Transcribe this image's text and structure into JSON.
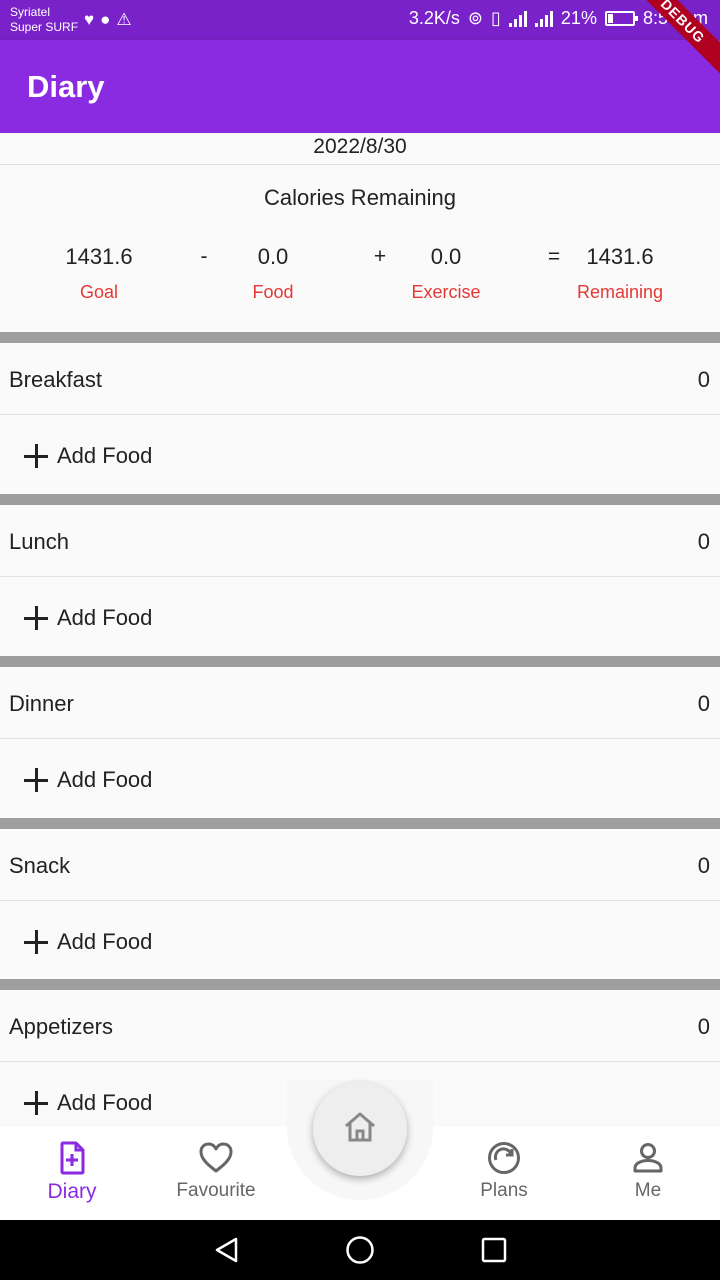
{
  "status_bar": {
    "carrier_line1": "Syriatel",
    "carrier_line2": "Super SURF",
    "net_speed": "3.2K/s",
    "battery_pct": "21%",
    "battery_level": 0.21,
    "time": "8:59 am"
  },
  "app_bar": {
    "title": "Diary",
    "debug_banner": "DEBUG"
  },
  "date": "2022/8/30",
  "calories": {
    "title": "Calories Remaining",
    "goal_value": "1431.6",
    "goal_label": "Goal",
    "minus": "-",
    "food_value": "0.0",
    "food_label": "Food",
    "plus": "+",
    "exercise_value": "0.0",
    "exercise_label": "Exercise",
    "equals": "=",
    "remaining_value": "1431.6",
    "remaining_label": "Remaining"
  },
  "meals": [
    {
      "name": "Breakfast",
      "count": "0",
      "add_label": "Add Food"
    },
    {
      "name": "Lunch",
      "count": "0",
      "add_label": "Add Food"
    },
    {
      "name": "Dinner",
      "count": "0",
      "add_label": "Add Food"
    },
    {
      "name": "Snack",
      "count": "0",
      "add_label": "Add Food"
    },
    {
      "name": "Appetizers",
      "count": "0",
      "add_label": "Add Food"
    }
  ],
  "bottom_nav": {
    "diary": "Diary",
    "favourite": "Favourite",
    "plans": "Plans",
    "me": "Me",
    "active": "diary"
  },
  "colors": {
    "primary": "#8a2be2",
    "status_bar": "#7a22c9",
    "accent_label": "#e53935",
    "divider": "#9e9e9e"
  }
}
